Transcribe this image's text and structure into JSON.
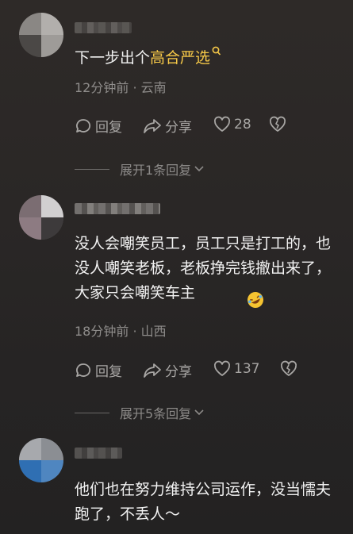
{
  "comments": [
    {
      "text_before": "下一步出个",
      "link": "高合严选",
      "meta": "12分钟前 · 云南",
      "reply_label": "回复",
      "share_label": "分享",
      "likes": "28",
      "expand": "展开1条回复"
    },
    {
      "text": "没人会嘲笑员工，员工只是打工的，也没人嘲笑老板，老板挣完钱撤出来了，大家只会嘲笑车主",
      "meta": "18分钟前 · 山西",
      "reply_label": "回复",
      "share_label": "分享",
      "likes": "137",
      "expand": "展开5条回复"
    },
    {
      "text": "他们也在努力维持公司运作，没当懦夫跑了，不丢人～"
    }
  ],
  "icons": {
    "reply": "comment-bubble-icon",
    "share": "share-arrow-icon",
    "like": "heart-icon",
    "dislike": "broken-heart-icon",
    "search": "search-magnifier-icon",
    "expand": "chevron-down-icon",
    "emoji": "rolling-laugh-emoji-icon"
  },
  "colors": {
    "link": "#f7c948",
    "meta": "#8f8d8b"
  }
}
